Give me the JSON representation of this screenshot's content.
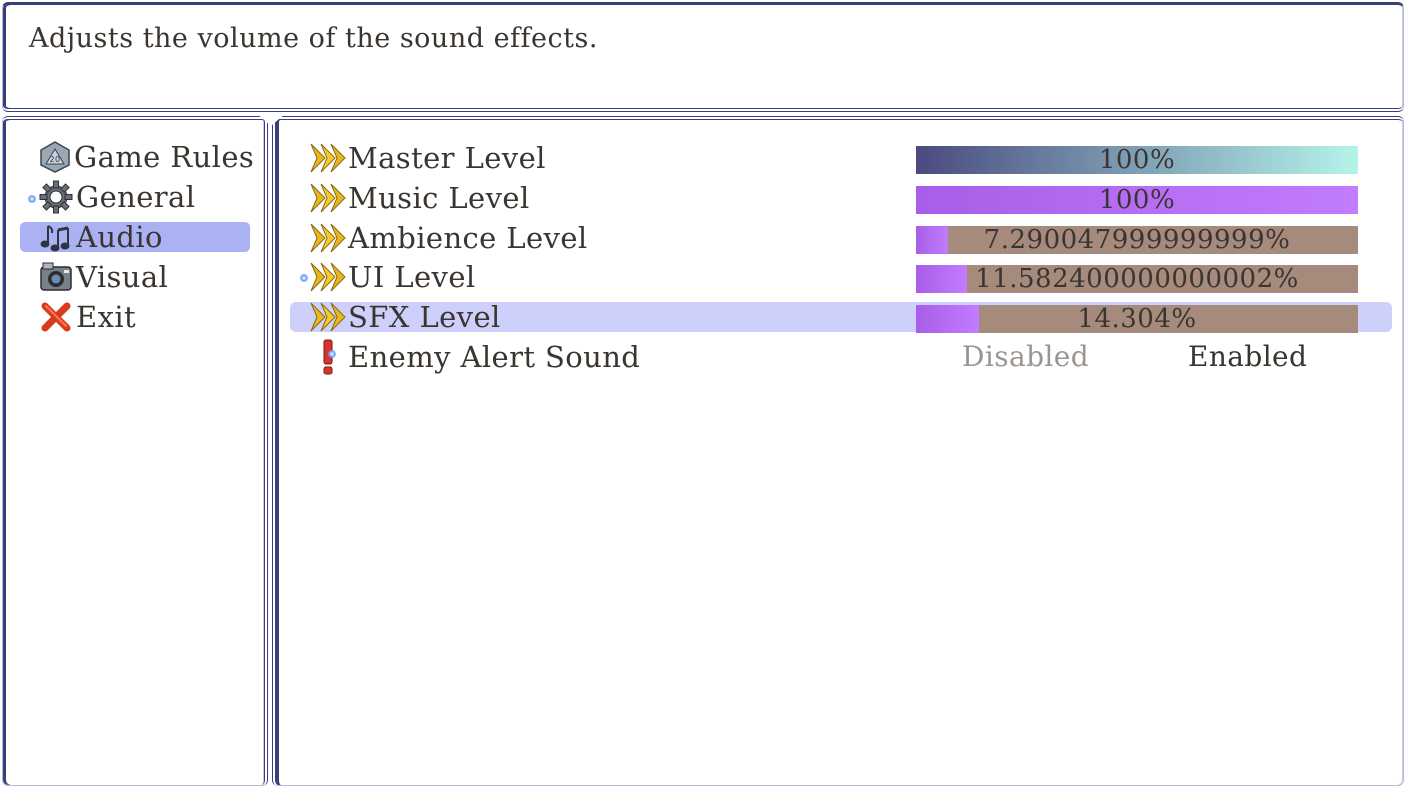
{
  "help": {
    "text": "Adjusts the volume of the sound effects."
  },
  "commands": [
    {
      "label": "Game Rules",
      "icon": "d20-dice-icon",
      "active": false
    },
    {
      "label": "General",
      "icon": "gear-icon",
      "active": false
    },
    {
      "label": "Audio",
      "icon": "music-note-icon",
      "active": true
    },
    {
      "label": "Visual",
      "icon": "camera-icon",
      "active": false
    },
    {
      "label": "Exit",
      "icon": "red-x-icon",
      "active": false
    }
  ],
  "options": [
    {
      "label": "Master Level",
      "icon": "double-arrow-icon",
      "type": "gauge",
      "value_text": "100%",
      "value": 100
    },
    {
      "label": "Music Level",
      "icon": "double-arrow-icon",
      "type": "gauge",
      "value_text": "100%",
      "value": 100
    },
    {
      "label": "Ambience Level",
      "icon": "double-arrow-icon",
      "type": "gauge",
      "value_text": "7.290047999999999%",
      "value": 7.290047999999999
    },
    {
      "label": "UI Level",
      "icon": "double-arrow-icon",
      "type": "gauge",
      "value_text": "11.582400000000002%",
      "value": 11.582400000000002
    },
    {
      "label": "SFX Level",
      "icon": "double-arrow-icon",
      "type": "gauge",
      "value_text": "14.304%",
      "value": 14.304,
      "active": true
    },
    {
      "label": "Enemy Alert Sound",
      "icon": "exclamation-icon",
      "type": "toggle",
      "off_text": "Disabled",
      "on_text": "Enabled",
      "state": "Enabled"
    }
  ],
  "colors": {
    "window_border": "#3a3f7a",
    "command_highlight": "#aab2f4",
    "row_highlight": "#cdd0fa",
    "gauge_bg": "#a68a7c",
    "master_gauge_start": "#4a4a80",
    "master_gauge_end": "#b4f4ea",
    "gauge_fill_start": "#a85ee8",
    "gauge_fill_end": "#c27cff"
  }
}
